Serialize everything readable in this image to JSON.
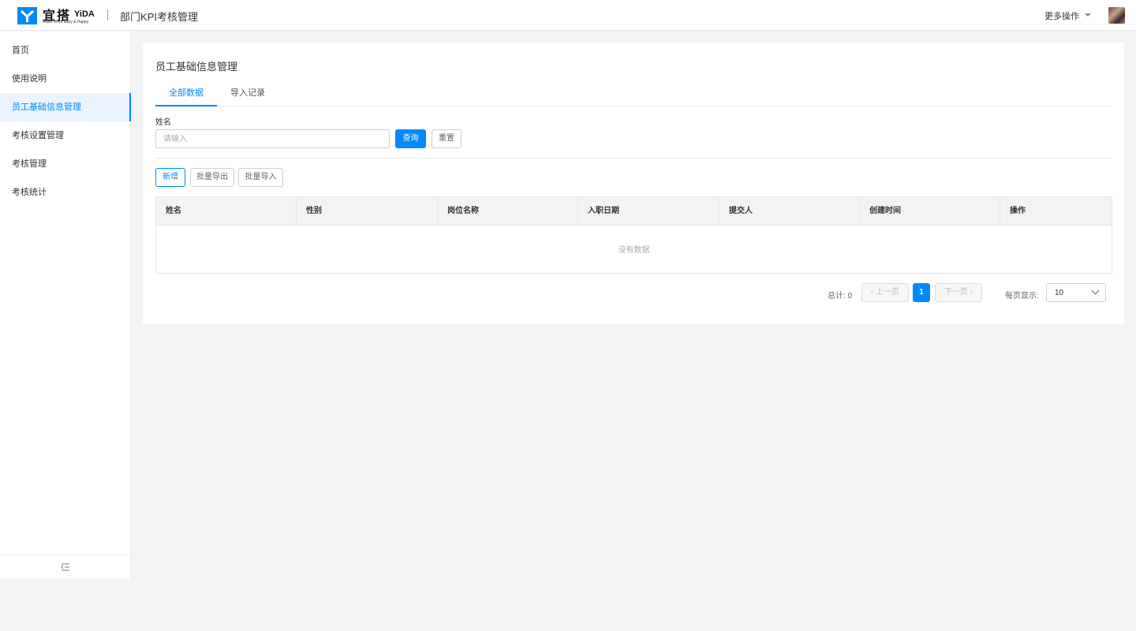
{
  "header": {
    "brand_cn": "宜搭",
    "brand_en": "YiDA",
    "brand_tagline": "Make Work Easy & Happy",
    "app_title": "部门KPI考核管理",
    "more_ops": "更多操作"
  },
  "sidebar": {
    "items": [
      {
        "label": "首页"
      },
      {
        "label": "使用说明"
      },
      {
        "label": "员工基础信息管理"
      },
      {
        "label": "考核设置管理"
      },
      {
        "label": "考核管理"
      },
      {
        "label": "考核统计"
      }
    ],
    "active_index": 2
  },
  "main": {
    "title": "员工基础信息管理",
    "tabs": [
      {
        "label": "全部数据",
        "active": true
      },
      {
        "label": "导入记录",
        "active": false
      }
    ],
    "filter": {
      "name_label": "姓名",
      "name_placeholder": "请输入",
      "name_value": "",
      "search_label": "查询",
      "reset_label": "重置"
    },
    "actions": {
      "add_label": "新增",
      "export_label": "批量导出",
      "import_label": "批量导入"
    },
    "table": {
      "columns": [
        "姓名",
        "性别",
        "岗位名称",
        "入职日期",
        "提交人",
        "创建时间",
        "操作"
      ],
      "rows": [],
      "empty_text": "没有数据"
    },
    "pagination": {
      "total_text": "总计: 0",
      "prev_label": "上一页",
      "next_label": "下一页",
      "current_page": "1",
      "page_size_label": "每页显示:",
      "page_size": "10"
    }
  },
  "colors": {
    "accent": "#0089ff",
    "background": "#f2f3f5"
  }
}
